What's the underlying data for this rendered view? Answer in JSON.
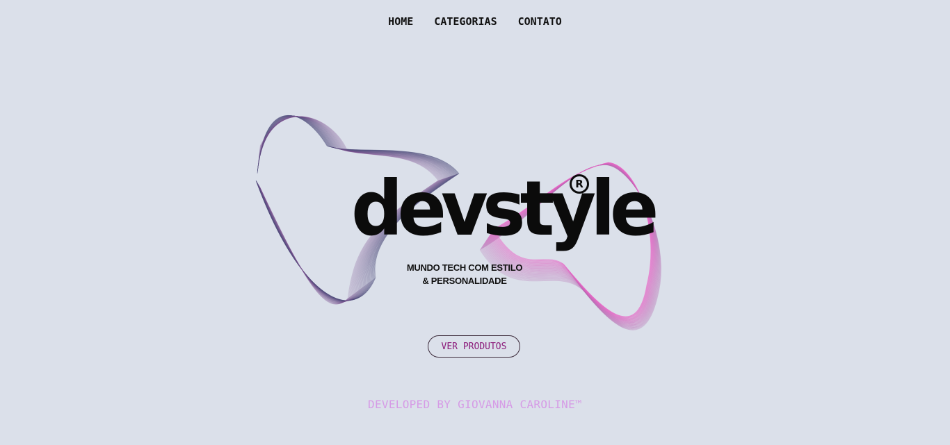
{
  "nav": {
    "items": [
      {
        "label": "HOME"
      },
      {
        "label": "CATEGORIAS"
      },
      {
        "label": "CONTATO"
      }
    ]
  },
  "hero": {
    "logo_text": "devstyle",
    "registered_mark": "R",
    "tagline_line1": "MUNDO TECH COM ESTILO",
    "tagline_line2": "& PERSONALIDADE"
  },
  "cta": {
    "label": "VER PRODUTOS"
  },
  "footer": {
    "text": "DEVELOPED BY GIOVANNA CAROLINE™"
  },
  "colors": {
    "background": "#dbe0ea",
    "text": "#111111",
    "cta_text": "#8b1a7a",
    "footer_text": "#d69be6",
    "wave_left": "#4a4a78",
    "wave_right": "#e86ac8"
  }
}
